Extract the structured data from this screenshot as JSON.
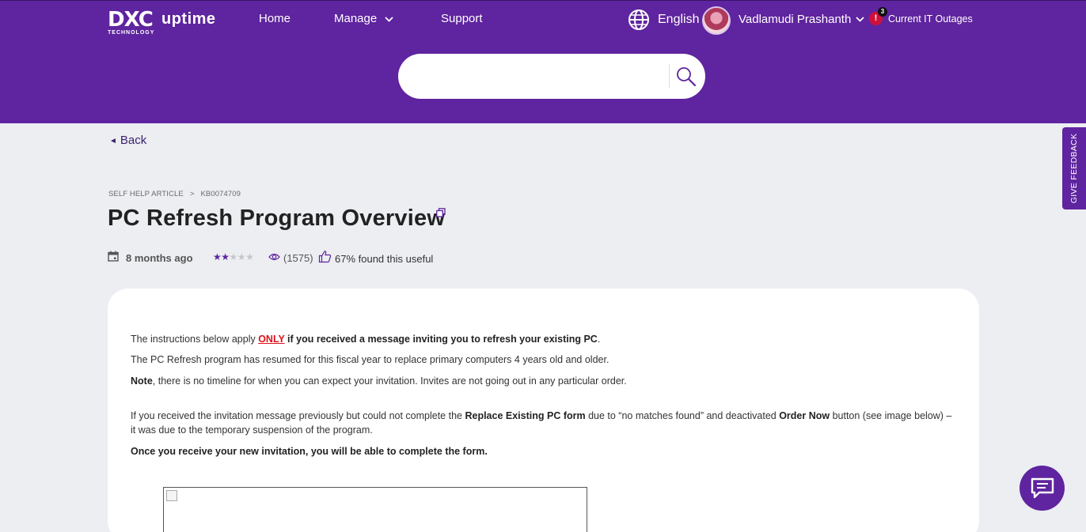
{
  "header": {
    "logo_text": "DXC",
    "logo_subtext": "TECHNOLOGY",
    "logo_product": "uptime",
    "nav": {
      "home": "Home",
      "manage": "Manage",
      "support": "Support"
    },
    "language": "English",
    "user_name": "Vadlamudi Prashanth",
    "outage_count": "3",
    "outage_label": "Current IT Outages"
  },
  "search": {
    "value": "",
    "placeholder": ""
  },
  "back_label": "Back",
  "feedback_label": "GIVE FEEDBACK",
  "breadcrumb": {
    "section": "SELF HELP ARTICLE",
    "separator": ">",
    "article_id": "KB0074709"
  },
  "article": {
    "title": "PC Refresh Program Overview",
    "updated": "8 months ago",
    "rating": 2,
    "rating_max": 5,
    "views": "(1575)",
    "useful": "67% found this useful"
  },
  "content": {
    "p1_a": "The instructions below apply ",
    "p1_only": "ONLY",
    "p1_b": " if you received a message inviting you to refresh your existing PC",
    "p1_c": ".",
    "p2": "The PC Refresh program has resumed for this fiscal year to replace primary computers 4 years old and older.",
    "p3_a": "Note",
    "p3_b": ", there is no timeline for when you can expect your invitation. Invites are not going out in any particular order.",
    "p4_a": "If you received the invitation message previously but could not complete the ",
    "p4_b": "Replace Existing PC form",
    "p4_c": " due to “no matches found” and deactivated ",
    "p4_d": "Order Now",
    "p4_e": " button (see image below) –",
    "p4_f": "it was due to the temporary suspension of the program.",
    "p5": "Once you receive your new invitation, you will be able to complete the form."
  },
  "colors": {
    "brand": "#5f249f",
    "alert": "#e0101a",
    "page_bg": "#eceef2"
  }
}
